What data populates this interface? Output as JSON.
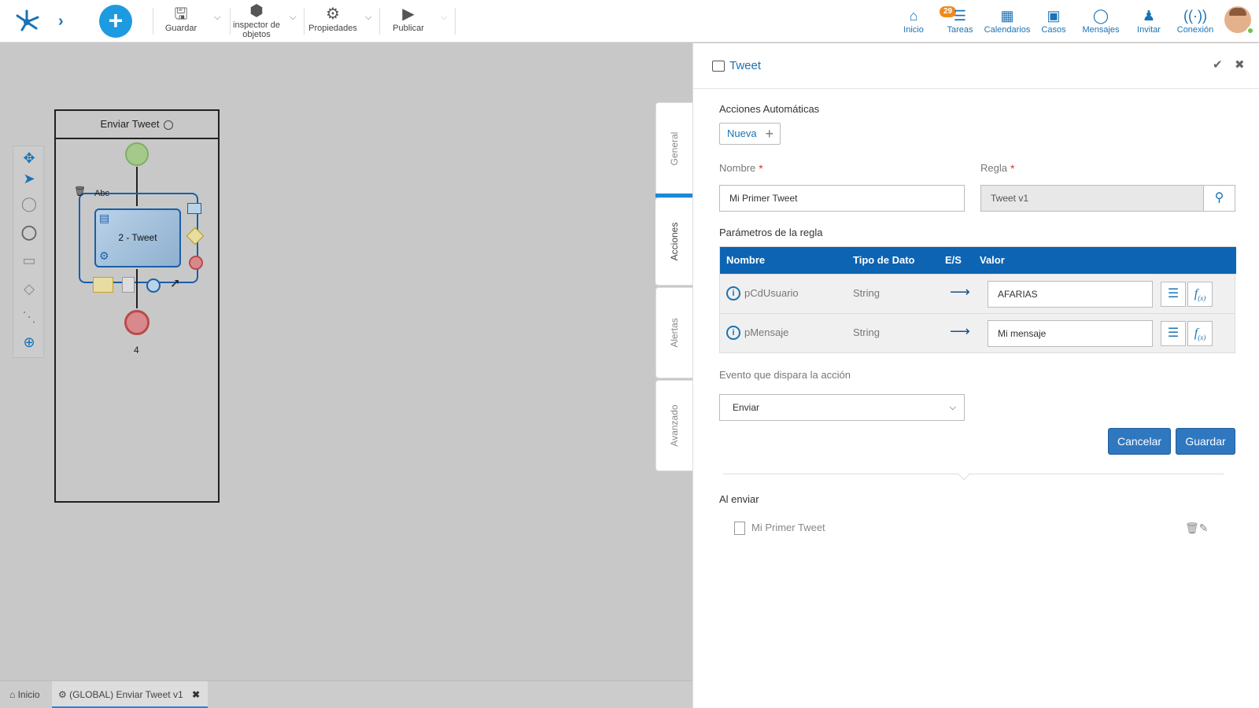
{
  "toolbar": {
    "save": "Guardar",
    "inspector_line1": "inspector de",
    "inspector_line2": "objetos",
    "properties": "Propiedades",
    "publish": "Publicar"
  },
  "nav": {
    "home": "Inicio",
    "tasks": "Tareas",
    "tasks_badge": "29",
    "calendars": "Calendarios",
    "cases": "Casos",
    "messages": "Mensajes",
    "invite": "Invitar",
    "connection": "Conexión"
  },
  "diagram": {
    "pool_title": "Enviar Tweet",
    "task_label": "2 - Tweet",
    "text_handle": "Abc",
    "end_label": "4"
  },
  "bottom_tabs": {
    "home": "Inicio",
    "active": "(GLOBAL) Enviar Tweet v1"
  },
  "side_tabs": {
    "general": "General",
    "actions": "Acciones",
    "alerts": "Alertas",
    "advanced": "Avanzado"
  },
  "panel": {
    "title": "Tweet",
    "section_title": "Acciones Automáticas",
    "new_button": "Nueva",
    "name_label": "Nombre",
    "name_value": "Mi Primer Tweet",
    "rule_label": "Regla",
    "rule_value": "Tweet v1",
    "params_title": "Parámetros de la regla",
    "params_headers": [
      "Nombre",
      "Tipo de Dato",
      "E/S",
      "Valor"
    ],
    "params": [
      {
        "name": "pCdUsuario",
        "type": "String",
        "value": "AFARIAS"
      },
      {
        "name": "pMensaje",
        "type": "String",
        "value": "Mi mensaje"
      }
    ],
    "event_label": "Evento que dispara la acción",
    "event_value": "Enviar",
    "cancel": "Cancelar",
    "save": "Guardar",
    "group_title": "Al enviar",
    "group_item": "Mi Primer Tweet"
  },
  "colors": {
    "accent": "#1a73b5",
    "table_header": "#0c64b3",
    "primary_button": "#2f78c0"
  }
}
